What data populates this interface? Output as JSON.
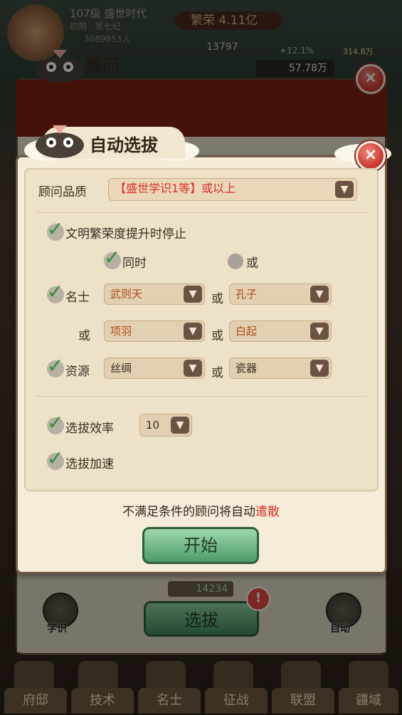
{
  "top": {
    "level": "107级 盛世时代",
    "era": "初期 · 第七纪",
    "population": "3689853人",
    "prosperity": "繁荣 4.11亿",
    "stat_main": "13797",
    "stat_growth": "+12.1%",
    "stat_right": "314.8万",
    "gold": "57.78万"
  },
  "back_panel": {
    "title": "顾问",
    "score": "14234",
    "select_button": "选拔",
    "badge": "!",
    "left_icon_label": "学识",
    "right_icon_label": "自动"
  },
  "modal": {
    "title": "自动选拔",
    "quality_label": "顾问品质",
    "quality_value": "【盛世学识1等】或以上",
    "stop_on_prosperity": "文明繁荣度提升时停止",
    "mode_and": "同时",
    "mode_or": "或",
    "famous_label": "名士",
    "famous": [
      "武则天",
      "孔子",
      "项羽",
      "白起"
    ],
    "or_text": "或",
    "resource_label": "资源",
    "resources": [
      "丝绸",
      "瓷器"
    ],
    "efficiency_label": "选拔效率",
    "efficiency_value": "10",
    "accelerate_label": "选拔加速",
    "notice_prefix": "不满足条件的顾问将自动",
    "notice_highlight": "遣散",
    "start_button": "开始",
    "close": "×"
  },
  "nav": [
    "府邸",
    "技术",
    "名士",
    "征战",
    "联盟",
    "疆域"
  ],
  "colors": {
    "accent_red": "#d8322a",
    "check_green": "#2f8f3c",
    "button_green": "#4d9a6a",
    "option_text": "#b04a1a"
  }
}
